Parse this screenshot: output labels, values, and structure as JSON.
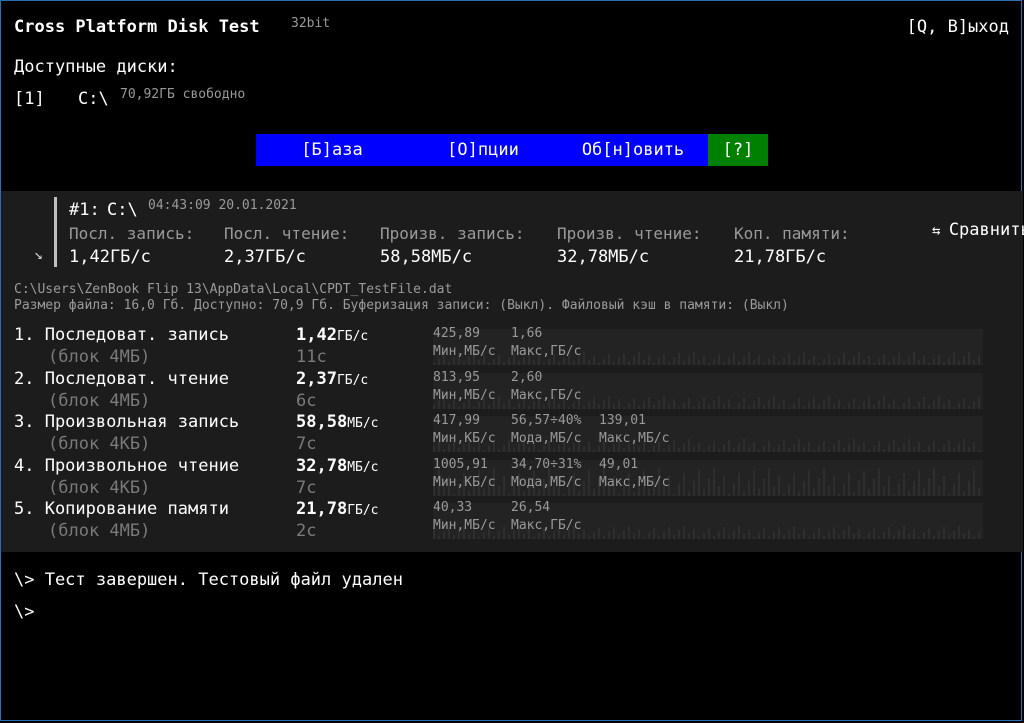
{
  "header": {
    "title": "Cross Platform Disk Test",
    "bitness": "32bit",
    "quit": "[Q, В]ыход"
  },
  "disks": {
    "heading": "Доступные диски:",
    "items": [
      {
        "index": "[1]",
        "drive": "C:\\",
        "free": "70,92ГБ свободно"
      }
    ]
  },
  "menu": {
    "items": [
      {
        "label": "[Б]аза"
      },
      {
        "label": "[О]пции"
      },
      {
        "label": "Об[н]овить"
      },
      {
        "label": "[?]"
      }
    ]
  },
  "result": {
    "id": "#1:",
    "drive": "C:\\",
    "datetime": "04:43:09 20.01.2021",
    "compare": "Сравнить",
    "compare_icon": "swap-arrows-icon",
    "expand_icon": "arrow-down-right-icon",
    "labels": [
      "Посл. запись:",
      "Посл. чтение:",
      "Произв. запись:",
      "Произв. чтение:",
      "Коп. памяти:"
    ],
    "values": [
      "1,42ГБ/с",
      "2,37ГБ/с",
      "58,58МБ/с",
      "32,78МБ/с",
      "21,78ГБ/с"
    ]
  },
  "file": {
    "path": "C:\\Users\\ZenBook Flip 13\\AppData\\Local\\CPDT_TestFile.dat",
    "info": "Размер файла: 16,0 Гб. Доступно: 70,9 Гб. Буферизация записи: (Выкл). Файловый кэш в памяти: (Выкл)"
  },
  "tests": [
    {
      "name": "1. Последоват. запись",
      "block": "(блок 4МБ)",
      "value": "1,42",
      "unit": "ГБ/с",
      "time": "11с",
      "stats": [
        {
          "v": "425,89",
          "l": "Мин,МБ/с"
        },
        {
          "v": "1,66",
          "l": "Макс,ГБ/с"
        }
      ]
    },
    {
      "name": "2. Последоват. чтение",
      "block": "(блок 4МБ)",
      "value": "2,37",
      "unit": "ГБ/с",
      "time": "6с",
      "stats": [
        {
          "v": "813,95",
          "l": "Мин,МБ/с"
        },
        {
          "v": "2,60",
          "l": "Макс,ГБ/с"
        }
      ]
    },
    {
      "name": "3. Произвольная запись",
      "block": "(блок 4КБ)",
      "value": "58,58",
      "unit": "МБ/с",
      "time": "7с",
      "stats": [
        {
          "v": "417,99",
          "l": "Мин,КБ/с"
        },
        {
          "v": "56,57÷40%",
          "l": "Мода,МБ/с"
        },
        {
          "v": "139,01",
          "l": "Макс,МБ/с"
        }
      ]
    },
    {
      "name": "4. Произвольное чтение",
      "block": "(блок 4КБ)",
      "value": "32,78",
      "unit": "МБ/с",
      "time": "7с",
      "stats": [
        {
          "v": "1005,91",
          "l": "Мин,КБ/с"
        },
        {
          "v": "34,70÷31%",
          "l": "Мода,МБ/с"
        },
        {
          "v": "49,01",
          "l": "Макс,МБ/с"
        }
      ]
    },
    {
      "name": "5. Копирование памяти",
      "block": "(блок 4МБ)",
      "value": "21,78",
      "unit": "ГБ/с",
      "time": "2с",
      "stats": [
        {
          "v": "40,33",
          "l": "Мин,МБ/с"
        },
        {
          "v": "26,54",
          "l": "Макс,ГБ/с"
        }
      ]
    }
  ],
  "console": {
    "lines": [
      "\\> Тест завершен. Тестовый файл удален",
      "\\>"
    ]
  }
}
